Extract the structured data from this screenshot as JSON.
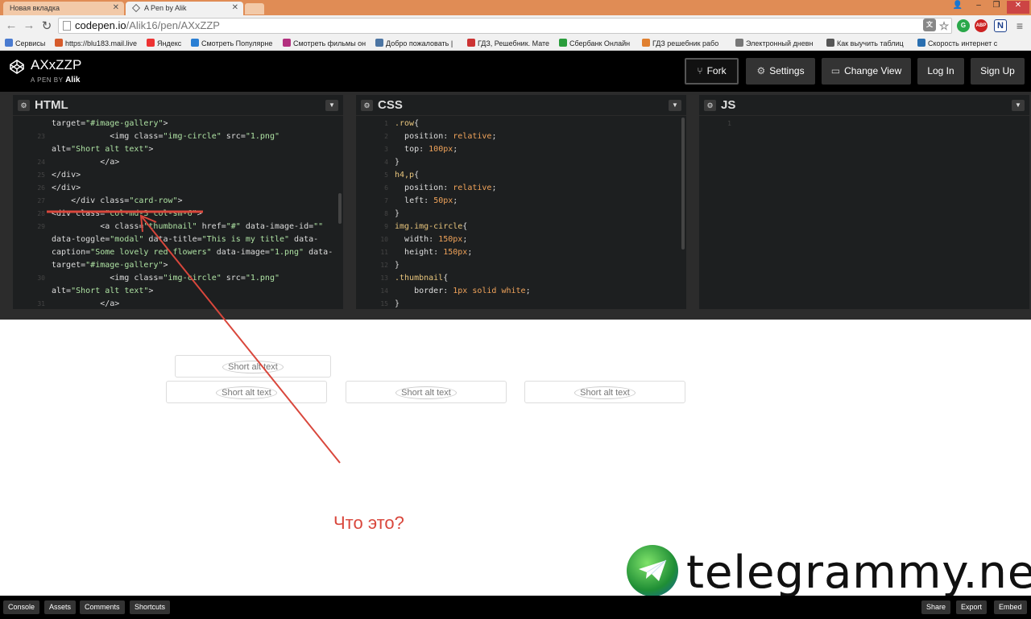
{
  "browser": {
    "tabs": [
      {
        "title": "Новая вкладка"
      },
      {
        "title": "A Pen by Alik"
      }
    ],
    "url_host": "codepen.io",
    "url_path": "/Alik16/pen/AXxZZP",
    "bookmarks": [
      {
        "label": "Сервисы",
        "color": "#4a7bd0"
      },
      {
        "label": "https://blu183.mail.live",
        "color": "#d65b2b"
      },
      {
        "label": "Яндекс",
        "color": "#e33"
      },
      {
        "label": "Смотреть Популярнe",
        "color": "#2a7fd4"
      },
      {
        "label": "Смотреть фильмы он",
        "color": "#b3307f"
      },
      {
        "label": "Добро пожаловать |",
        "color": "#4c75a3"
      },
      {
        "label": "ГДЗ, Решебник. Мате",
        "color": "#c33"
      },
      {
        "label": "Сбербанк Онлайн",
        "color": "#2a9d3c"
      },
      {
        "label": "ГДЗ решебник рабо",
        "color": "#e08030"
      },
      {
        "label": "Электронный дневн",
        "color": "#777"
      },
      {
        "label": "Как выучить таблиц",
        "color": "#555"
      },
      {
        "label": "Скорость интернет с",
        "color": "#2a6fb0"
      }
    ]
  },
  "header": {
    "title": "AXxZZP",
    "by_prefix": "A PEN BY",
    "author": "Alik",
    "buttons": {
      "fork": "Fork",
      "settings": "Settings",
      "change_view": "Change View",
      "login": "Log In",
      "signup": "Sign Up"
    }
  },
  "editors": {
    "html_label": "HTML",
    "css_label": "CSS",
    "js_label": "JS",
    "html_lines": [
      {
        "n": "",
        "t": "target=\"#image-gallery\">"
      },
      {
        "n": "23",
        "t": "            <img class=\"img-circle\" src=\"1.png\""
      },
      {
        "n": "",
        "t": "alt=\"Short alt text\">"
      },
      {
        "n": "24",
        "t": "          </a>"
      },
      {
        "n": "25",
        "t": "</div>"
      },
      {
        "n": "26",
        "t": "</div>"
      },
      {
        "n": "27",
        "t": "    </div class=\"card-row\">"
      },
      {
        "n": "28",
        "t": "<div class=\"col-md-3 col-sm-6\">"
      },
      {
        "n": "29",
        "t": "          <a class=\"thumbnail\" href=\"#\" data-image-id=\"\""
      },
      {
        "n": "",
        "t": "data-toggle=\"modal\" data-title=\"This is my title\" data-"
      },
      {
        "n": "",
        "t": "caption=\"Some lovely red flowers\" data-image=\"1.png\" data-"
      },
      {
        "n": "",
        "t": "target=\"#image-gallery\">"
      },
      {
        "n": "30",
        "t": "            <img class=\"img-circle\" src=\"1.png\""
      },
      {
        "n": "",
        "t": "alt=\"Short alt text\">"
      },
      {
        "n": "31",
        "t": "          </a>"
      }
    ],
    "css_lines": [
      {
        "n": "1",
        "t": ".row{"
      },
      {
        "n": "2",
        "t": "  position: relative;"
      },
      {
        "n": "3",
        "t": "  top: 100px;"
      },
      {
        "n": "4",
        "t": "}"
      },
      {
        "n": "5",
        "t": "h4,p{"
      },
      {
        "n": "6",
        "t": "  position: relative;"
      },
      {
        "n": "7",
        "t": "  left: 50px;"
      },
      {
        "n": "8",
        "t": "}"
      },
      {
        "n": "9",
        "t": "img.img-circle{"
      },
      {
        "n": "10",
        "t": "  width: 150px;"
      },
      {
        "n": "11",
        "t": "  height: 150px;"
      },
      {
        "n": "12",
        "t": "}"
      },
      {
        "n": "13",
        "t": ".thumbnail{"
      },
      {
        "n": "14",
        "t": "    border: 1px solid white;"
      },
      {
        "n": "15",
        "t": "}"
      }
    ],
    "js_lines": [
      {
        "n": "1",
        "t": ""
      }
    ]
  },
  "result": {
    "alt_text": "Short alt text",
    "question": "Что это?",
    "watermark": "telegrammy.net"
  },
  "footer": {
    "left": [
      "Console",
      "Assets",
      "Comments",
      "Shortcuts"
    ],
    "right": [
      "Share",
      "Export",
      "Embed"
    ]
  },
  "colors": {
    "annotation": "#d9473c",
    "cp_black": "#000000",
    "editor_bg": "#1d1f20"
  }
}
